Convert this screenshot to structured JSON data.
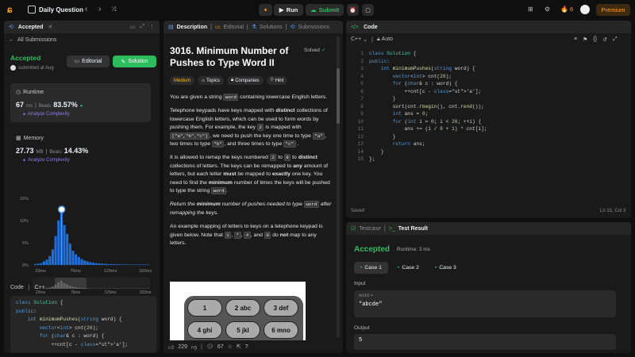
{
  "topbar": {
    "title": "Daily Question",
    "run_label": "Run",
    "submit_label": "Submit",
    "streak": "6",
    "premium_label": "Premium"
  },
  "left": {
    "tab_label": "Accepted",
    "all_submissions": "All Submissions",
    "status": "Accepted",
    "submitted_at": "submitted at Aug",
    "editorial_label": "Editorial",
    "solution_label": "Solution",
    "runtime_label": "Runtime",
    "runtime_value": "67",
    "runtime_unit": "ms",
    "runtime_beats_label": "Beats",
    "runtime_beats": "83.57%",
    "analyze_label": "Analyze Complexity",
    "memory_label": "Memory",
    "memory_value": "27.73",
    "memory_unit": "MB",
    "memory_beats_label": "Beats",
    "memory_beats": "14.43%",
    "analyze_label2": "Analyze Complexity",
    "code_label": "Code",
    "lang": "C++"
  },
  "chart_data": {
    "type": "bar",
    "y_ticks": [
      "15%",
      "10%",
      "5%",
      "0%"
    ],
    "ylim": [
      0,
      15
    ],
    "x_ticks": [
      "23ms",
      "76ms",
      "129ms",
      "183ms"
    ],
    "x_ticks_mini": [
      "23ms",
      "76ms",
      "129ms",
      "183ms"
    ],
    "highlight_bar": 9,
    "values": [
      0.2,
      0.3,
      0.4,
      0.8,
      1.2,
      2.0,
      3.5,
      6.5,
      10.0,
      12.5,
      9.0,
      7.0,
      4.8,
      3.2,
      2.4,
      1.8,
      1.3,
      1.0,
      0.8,
      0.6,
      0.5,
      0.4,
      0.35,
      0.3,
      0.25,
      0.2,
      0.2,
      0.18,
      0.15,
      0.15,
      0.12,
      0.12,
      0.1,
      0.1,
      0.1,
      0.1,
      0.1,
      0.1,
      0.1,
      0.1
    ],
    "colors": {
      "bar": "#1e6fd9",
      "highlight": "#ffffff"
    }
  },
  "desc_tabs": {
    "description": "Description",
    "editorial": "Editorial",
    "solutions": "Solutions",
    "submissions": "Submissions"
  },
  "problem": {
    "title": "3016. Minimum Number of Pushes to Type Word II",
    "solved_label": "Solved",
    "difficulty": "Medium",
    "topics": "Topics",
    "companies": "Companies",
    "hint": "Hint",
    "p1_a": "You are given a string",
    "p1_code": "word",
    "p1_b": "containing lowercase English letters.",
    "p2_a": "Telephone keypads have keys mapped with",
    "p2_b": "distinct",
    "p2_c": "collections of lowercase English letters, which can be used to form words by pushing them. For example, the key",
    "p2_code1": "2",
    "p2_d": "is mapped with",
    "p2_code2": "[\"a\",\"b\",\"c\"]",
    "p2_e": ", we need to push the key one time to type",
    "p2_code3": "\"a\"",
    "p2_f": ", two times to type",
    "p2_code4": "\"b\"",
    "p2_g": ", and three times to type",
    "p2_code5": "\"c\"",
    "p2_h": ".",
    "p3_a": "It is allowed to remap the keys numbered",
    "p3_code1": "2",
    "p3_b": "to",
    "p3_code2": "9",
    "p3_c": "to",
    "p3_d": "distinct",
    "p3_e": "collections of letters. The keys can be remapped to",
    "p3_f": "any",
    "p3_g": "amount of letters, but each letter",
    "p3_h": "must",
    "p3_i": "be mapped to",
    "p3_j": "exactly",
    "p3_k": "one key. You need to find the",
    "p3_l": "minimum",
    "p3_m": "number of times the keys will be pushed to type the string",
    "p3_code3": "word",
    "p3_n": ".",
    "p4_a": "Return the",
    "p4_b": "minimum",
    "p4_c": "number of pushes needed to type",
    "p4_code": "word",
    "p4_d": "after remapping the keys.",
    "p5_a": "An example mapping of letters to keys on a telephone keypad is given below. Note that",
    "p5_c1": "1",
    "p5_c2": "*",
    "p5_c3": "#",
    "p5_c4": "0",
    "p5_b": ", and",
    "p5_c": "do",
    "p5_d": "not",
    "p5_e": "map to any letters.",
    "keys": [
      "1",
      "2 abc",
      "3 def",
      "4 ghi",
      "5 jkl",
      "6 mno"
    ],
    "likes": "229",
    "comments": "67"
  },
  "code_panel": {
    "title": "Code",
    "lang": "C++",
    "auto": "Auto",
    "saved": "Saved",
    "cursor": "Ln 15, Col 3"
  },
  "code_lines": [
    "class Solution {",
    "public:",
    "    int minimumPushes(string word) {",
    "        vector<int> cnt(26);",
    "        for (char& c : word) {",
    "            ++cnt[c - 'a'];",
    "        }",
    "        sort(cnt.rbegin(), cnt.rend());",
    "        int ans = 0;",
    "        for (int i = 0; i < 26; ++i) {",
    "            ans += (i / 8 + 1) * cnt[i];",
    "        }",
    "        return ans;",
    "    }",
    "};"
  ],
  "left_code_lines": [
    "class Solution {",
    "public:",
    "    int minimumPushes(string word) {",
    "        vector<int> cnt(26);",
    "        for (char& c : word) {",
    "            ++cnt[c - 'a'];"
  ],
  "test": {
    "testcase_tab": "Testcase",
    "result_tab": "Test Result",
    "status": "Accepted",
    "runtime": "Runtime: 3 ms",
    "cases": [
      "Case 1",
      "Case 2",
      "Case 3"
    ],
    "input_label": "Input",
    "var_name": "word =",
    "var_value": "\"abcde\"",
    "output_label": "Output",
    "output_value": "5"
  }
}
